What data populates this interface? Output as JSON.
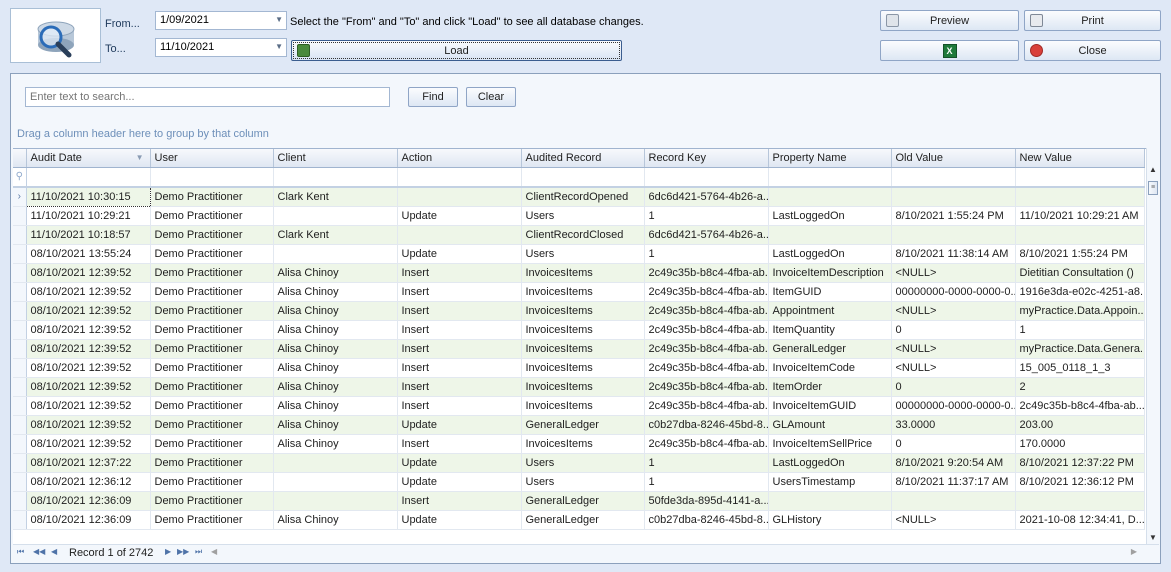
{
  "toolbar": {
    "from_label": "From...",
    "to_label": "To...",
    "from_date": "1/09/2021",
    "to_date": "11/10/2021",
    "hint": "Select the \"From\" and \"To\" and click \"Load\" to see all database changes.",
    "load_label": "Load",
    "preview_label": "Preview",
    "print_label": "Print",
    "export_label": "",
    "close_label": "Close"
  },
  "search": {
    "placeholder": "Enter text to search...",
    "find_label": "Find",
    "clear_label": "Clear"
  },
  "group_hint": "Drag a column header here to group by that column",
  "columns": [
    "Audit Date",
    "User",
    "Client",
    "Action",
    "Audited Record",
    "Record Key",
    "Property Name",
    "Old Value",
    "New Value"
  ],
  "rows": [
    [
      "11/10/2021 10:30:15",
      "Demo Practitioner",
      "Clark Kent",
      "",
      "ClientRecordOpened",
      "6dc6d421-5764-4b26-a...",
      "",
      "",
      ""
    ],
    [
      "11/10/2021 10:29:21",
      "Demo Practitioner",
      "",
      "Update",
      "Users",
      "1",
      "LastLoggedOn",
      "8/10/2021 1:55:24 PM",
      "11/10/2021 10:29:21 AM"
    ],
    [
      "11/10/2021 10:18:57",
      "Demo Practitioner",
      "Clark Kent",
      "",
      "ClientRecordClosed",
      "6dc6d421-5764-4b26-a...",
      "",
      "",
      ""
    ],
    [
      "08/10/2021 13:55:24",
      "Demo Practitioner",
      "",
      "Update",
      "Users",
      "1",
      "LastLoggedOn",
      "8/10/2021 11:38:14 AM",
      "8/10/2021 1:55:24 PM"
    ],
    [
      "08/10/2021 12:39:52",
      "Demo Practitioner",
      "Alisa Chinoy",
      "Insert",
      "InvoicesItems",
      "2c49c35b-b8c4-4fba-ab...",
      "InvoiceItemDescription",
      "<NULL>",
      "Dietitian Consultation ()"
    ],
    [
      "08/10/2021 12:39:52",
      "Demo Practitioner",
      "Alisa Chinoy",
      "Insert",
      "InvoicesItems",
      "2c49c35b-b8c4-4fba-ab...",
      "ItemGUID",
      "00000000-0000-0000-0...",
      "1916e3da-e02c-4251-a8..."
    ],
    [
      "08/10/2021 12:39:52",
      "Demo Practitioner",
      "Alisa Chinoy",
      "Insert",
      "InvoicesItems",
      "2c49c35b-b8c4-4fba-ab...",
      "Appointment",
      "<NULL>",
      "myPractice.Data.Appoin..."
    ],
    [
      "08/10/2021 12:39:52",
      "Demo Practitioner",
      "Alisa Chinoy",
      "Insert",
      "InvoicesItems",
      "2c49c35b-b8c4-4fba-ab...",
      "ItemQuantity",
      "0",
      "1"
    ],
    [
      "08/10/2021 12:39:52",
      "Demo Practitioner",
      "Alisa Chinoy",
      "Insert",
      "InvoicesItems",
      "2c49c35b-b8c4-4fba-ab...",
      "GeneralLedger",
      "<NULL>",
      "myPractice.Data.Genera..."
    ],
    [
      "08/10/2021 12:39:52",
      "Demo Practitioner",
      "Alisa Chinoy",
      "Insert",
      "InvoicesItems",
      "2c49c35b-b8c4-4fba-ab...",
      "InvoiceItemCode",
      "<NULL>",
      "15_005_0118_1_3"
    ],
    [
      "08/10/2021 12:39:52",
      "Demo Practitioner",
      "Alisa Chinoy",
      "Insert",
      "InvoicesItems",
      "2c49c35b-b8c4-4fba-ab...",
      "ItemOrder",
      "0",
      "2"
    ],
    [
      "08/10/2021 12:39:52",
      "Demo Practitioner",
      "Alisa Chinoy",
      "Insert",
      "InvoicesItems",
      "2c49c35b-b8c4-4fba-ab...",
      "InvoiceItemGUID",
      "00000000-0000-0000-0...",
      "2c49c35b-b8c4-4fba-ab..."
    ],
    [
      "08/10/2021 12:39:52",
      "Demo Practitioner",
      "Alisa Chinoy",
      "Update",
      "GeneralLedger",
      "c0b27dba-8246-45bd-8...",
      "GLAmount",
      "33.0000",
      "203.00"
    ],
    [
      "08/10/2021 12:39:52",
      "Demo Practitioner",
      "Alisa Chinoy",
      "Insert",
      "InvoicesItems",
      "2c49c35b-b8c4-4fba-ab...",
      "InvoiceItemSellPrice",
      "0",
      "170.0000"
    ],
    [
      "08/10/2021 12:37:22",
      "Demo Practitioner",
      "",
      "Update",
      "Users",
      "1",
      "LastLoggedOn",
      "8/10/2021 9:20:54 AM",
      "8/10/2021 12:37:22 PM"
    ],
    [
      "08/10/2021 12:36:12",
      "Demo Practitioner",
      "",
      "Update",
      "Users",
      "1",
      "UsersTimestamp",
      "8/10/2021 11:37:17 AM",
      "8/10/2021 12:36:12 PM"
    ],
    [
      "08/10/2021 12:36:09",
      "Demo Practitioner",
      "",
      "Insert",
      "GeneralLedger",
      "50fde3da-895d-4141-a...",
      "",
      "",
      ""
    ],
    [
      "08/10/2021 12:36:09",
      "Demo Practitioner",
      "Alisa Chinoy",
      "Update",
      "GeneralLedger",
      "c0b27dba-8246-45bd-8...",
      "GLHistory",
      "<NULL>",
      "2021-10-08 12:34:41, D..."
    ]
  ],
  "navigator": {
    "record_text": "Record 1 of 2742"
  },
  "icons": {
    "logo": "database-search-icon",
    "preview": "preview-icon",
    "print": "printer-icon",
    "export": "excel-icon",
    "close": "close-icon",
    "load": "load-icon"
  },
  "colors": {
    "background": "#dfe8f6",
    "row_highlight": "#eef6e8",
    "group_hint": "#6d8fb9"
  }
}
